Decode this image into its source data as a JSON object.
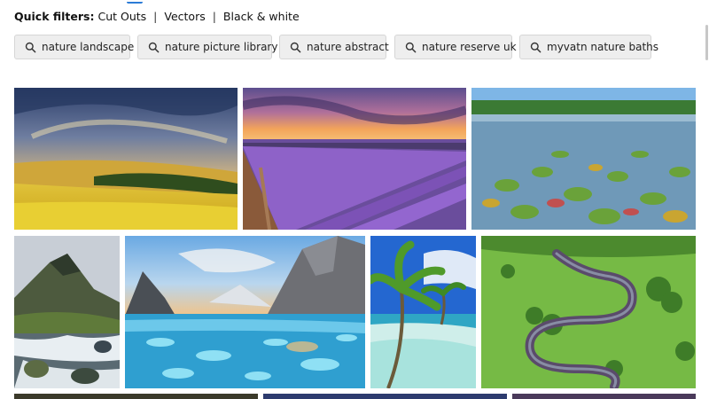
{
  "quick_filters": {
    "label": "Quick filters:",
    "links": [
      "Cut Outs",
      "Vectors",
      "Black & white"
    ],
    "separator": "|"
  },
  "related_searches": [
    {
      "label": "nature landscape",
      "icon": "search-icon"
    },
    {
      "label": "nature picture library",
      "icon": "search-icon"
    },
    {
      "label": "nature abstract",
      "icon": "search-icon"
    },
    {
      "label": "nature reserve uk",
      "icon": "search-icon"
    },
    {
      "label": "myvatn nature baths",
      "icon": "search-icon"
    }
  ],
  "images": [
    {
      "subject": "sunset over yellow rapeseed field",
      "colors": [
        "#3a4f7a",
        "#e8b64a",
        "#d7c12a"
      ]
    },
    {
      "subject": "lavender field rows at sunset",
      "colors": [
        "#6b4f9a",
        "#f29a4d",
        "#7a55b5"
      ]
    },
    {
      "subject": "lake with water lily pads",
      "colors": [
        "#6fa9e0",
        "#2f7a3a",
        "#7fb3c9"
      ]
    },
    {
      "subject": "mountain with waterfall",
      "colors": [
        "#c9cfd6",
        "#4c6b3a",
        "#dfe6ea"
      ]
    },
    {
      "subject": "glacier lagoon with turquoise ice",
      "colors": [
        "#7fb6e6",
        "#33b8e0",
        "#7c8a99"
      ]
    },
    {
      "subject": "tropical beach with palm trees",
      "colors": [
        "#2a6fd6",
        "#58a832",
        "#bfe8e6"
      ]
    },
    {
      "subject": "aerial view of meandering river through green meadow",
      "colors": [
        "#7fc24a",
        "#3b7d2a",
        "#5a4b6b"
      ]
    }
  ]
}
